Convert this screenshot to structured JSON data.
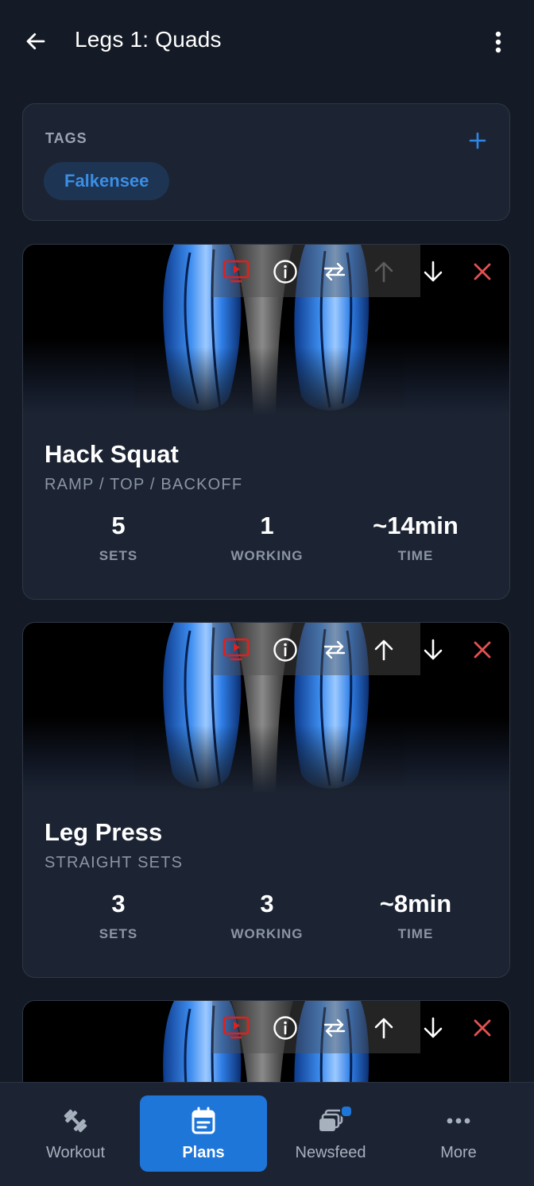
{
  "header": {
    "title": "Legs 1: Quads",
    "back_icon": "arrow-left-icon",
    "menu_icon": "kebab-menu-icon"
  },
  "tags": {
    "label": "TAGS",
    "add_icon": "plus-icon",
    "items": [
      "Falkensee"
    ]
  },
  "exercises": [
    {
      "name": "Hack Squat",
      "scheme": "RAMP / TOP / BACKOFF",
      "stats": [
        {
          "value": "5",
          "label": "SETS"
        },
        {
          "value": "1",
          "label": "WORKING"
        },
        {
          "value": "~14min",
          "label": "TIME"
        }
      ],
      "move_up_enabled": false
    },
    {
      "name": "Leg Press",
      "scheme": "STRAIGHT SETS",
      "stats": [
        {
          "value": "3",
          "label": "SETS"
        },
        {
          "value": "3",
          "label": "WORKING"
        },
        {
          "value": "~8min",
          "label": "TIME"
        }
      ],
      "move_up_enabled": true
    }
  ],
  "action_icons": [
    "video-icon",
    "info-icon",
    "swap-icon",
    "arrow-up-icon",
    "arrow-down-icon",
    "delete-x-icon"
  ],
  "colors": {
    "accent": "#1e76d9",
    "video": "#e0201c",
    "delete": "#e05252",
    "background": "#151b26",
    "card": "#1c2433"
  },
  "bottom_nav": [
    {
      "label": "Workout",
      "icon": "dumbbell-icon",
      "active": false
    },
    {
      "label": "Plans",
      "icon": "calendar-icon",
      "active": true
    },
    {
      "label": "Newsfeed",
      "icon": "newsfeed-icon",
      "active": false,
      "badge": true
    },
    {
      "label": "More",
      "icon": "more-dots-icon",
      "active": false
    }
  ]
}
